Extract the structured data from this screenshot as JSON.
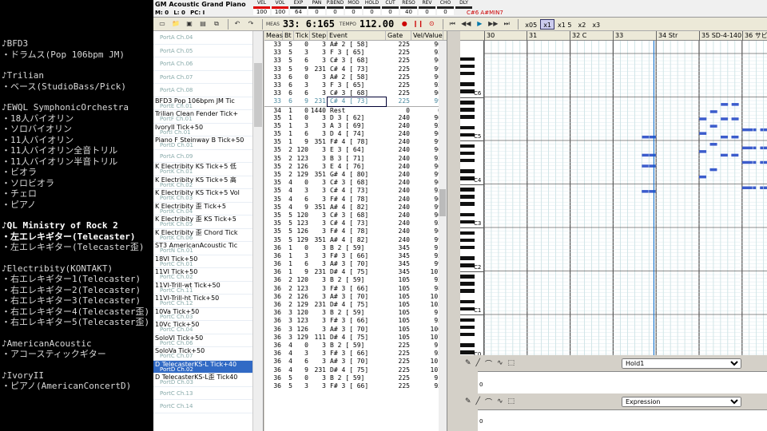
{
  "overlay": {
    "groups": [
      {
        "lines": [
          "♪BFD3",
          "・ドラムス(Pop 106bpm JM)"
        ]
      },
      {
        "lines": [
          "♪Trilian",
          "・ベース(StudioBass/Pick)"
        ]
      },
      {
        "lines": [
          "♪EWQL SymphonicOrchestra",
          "・18人バイオリン",
          "・ソロバイオリン",
          "・11人バイオリン",
          "・11人バイオリン全音トリル",
          "・11人バイオリン半音トリル",
          "・ビオラ",
          "・ソロビオラ",
          "・チェロ",
          "・ピアノ"
        ]
      },
      {
        "lines": [
          "♪QL Ministry of Rock 2",
          "・左エレキギター(Telecaster)",
          "・左エレキギター(Telecaster歪)"
        ],
        "current": [
          0,
          1
        ]
      },
      {
        "lines": [
          "♪Electribity(KONTAKT)",
          "・右エレキギター1(Telecaster)",
          "・右エレキギター2(Telecaster)",
          "・右エレキギター3(Telecaster)",
          "・右エレキギター4(Telecaster歪)",
          "・右エレキギター5(Telecaster歪)"
        ]
      },
      {
        "lines": [
          "♪AmericanAcoustic",
          "・アコースティックギター"
        ]
      },
      {
        "lines": [
          "♪IvoryII",
          "・ピアノ(AmericanConcertD)"
        ]
      }
    ]
  },
  "header": {
    "instrument": "GM Acoustic Grand Piano",
    "status": {
      "m": "M: 0",
      "l": "L: 0",
      "pc": "PC: I"
    },
    "meters": [
      {
        "label": "VEL",
        "value": "100"
      },
      {
        "label": "VOL",
        "value": "100"
      },
      {
        "label": "EXP",
        "value": "64"
      },
      {
        "label": "PAN",
        "value": "0"
      },
      {
        "label": "P.BEND",
        "value": "0"
      },
      {
        "label": "MOD",
        "value": "0"
      },
      {
        "label": "HOLD",
        "value": "0"
      },
      {
        "label": "CUT",
        "value": "0"
      },
      {
        "label": "RESO",
        "value": "40"
      },
      {
        "label": "REV",
        "value": "0"
      },
      {
        "label": "CHO",
        "value": "0"
      },
      {
        "label": "DLY",
        "value": ""
      }
    ],
    "key_info": "C#6 A#MIN7"
  },
  "toolbar": {
    "meas_label": "MEAS",
    "position": "33: 6:165",
    "tempo_label": "TEMPO",
    "tempo": "112.00",
    "zoom": [
      "x05",
      "x1",
      "x1 5",
      "x2",
      "x3"
    ]
  },
  "tracks": [
    {
      "name": "",
      "port": "PortA Ch.04"
    },
    {
      "name": "",
      "port": "PortA Ch.05"
    },
    {
      "name": "",
      "port": "PortA Ch.06"
    },
    {
      "name": "",
      "port": "PortA Ch.07"
    },
    {
      "name": "",
      "port": "PortA Ch.08"
    },
    {
      "name": "BFD3 Pop 106bpm JM Tic",
      "port": "PortE Ch.01"
    },
    {
      "name": "Trilian Clean Fender Tick+",
      "port": "PortF Ch.01"
    },
    {
      "name": "IvoryII Tick+50",
      "port": "PortI Ch.01"
    },
    {
      "name": "Piano F Steinway B Tick+50",
      "port": "PortD Ch.01"
    },
    {
      "name": "",
      "port": "PortA Ch.09"
    },
    {
      "name": "K Electribity KS Tick+5 低",
      "port": "PortK Ch.01"
    },
    {
      "name": "K Electribity KS Tick+5 高",
      "port": "PortK Ch.02"
    },
    {
      "name": "K Electribity KS Tick+5 Vol",
      "port": "PortK Ch.03"
    },
    {
      "name": "K Electribity 歪 Tick+5",
      "port": "PortK Ch.04"
    },
    {
      "name": "K Electribity 歪 KS Tick+5",
      "port": "PortK Ch.05"
    },
    {
      "name": "K Electribity 歪 Chord Tick",
      "port": "PortK Ch.06"
    },
    {
      "name": "ST3 AmericanAcoustic Tic",
      "port": "PortN Ch.01"
    },
    {
      "name": "18VI Tick+50",
      "port": "PortC Ch.01"
    },
    {
      "name": "11VI Tick+50",
      "port": "PortC Ch.02"
    },
    {
      "name": "11VI-Trill-wt Tick+50",
      "port": "PortC Ch.11"
    },
    {
      "name": "11VI-Trill-ht Tick+50",
      "port": "PortC Ch.12"
    },
    {
      "name": "10Va Tick+50",
      "port": "PortC Ch.03"
    },
    {
      "name": "10Vc Tick+50",
      "port": "PortC Ch.04"
    },
    {
      "name": "SoloVI Tick+50",
      "port": "PortC Ch.06"
    },
    {
      "name": "SoloVa Tick+50",
      "port": "PortC Ch.07"
    },
    {
      "name": "D TelecasterKS-L Tick+40",
      "port": "PortD Ch.02",
      "selected": true
    },
    {
      "name": "D TelecasterKS-L歪 Tick40",
      "port": "PortD Ch.03"
    },
    {
      "name": "",
      "port": "PortC Ch.13"
    },
    {
      "name": "",
      "port": "PortC Ch.14"
    }
  ],
  "event_columns": [
    "Meas",
    "Bt",
    "Tick",
    "Step",
    "Event",
    "Gate",
    "Vel/Value"
  ],
  "events": [
    [
      "33",
      "5",
      "0",
      "3",
      "A# 2 [ 58]",
      "225",
      "90"
    ],
    [
      "33",
      "5",
      "3",
      "3",
      "F 3 [ 65]",
      "225",
      "93"
    ],
    [
      "33",
      "5",
      "6",
      "3",
      "C# 3 [ 68]",
      "225",
      "96"
    ],
    [
      "33",
      "5",
      "9",
      "231",
      "C# 4 [ 73]",
      "225",
      "99"
    ],
    [
      "33",
      "6",
      "0",
      "3",
      "A# 2 [ 58]",
      "225",
      "90"
    ],
    [
      "33",
      "6",
      "3",
      "3",
      "F 3 [ 65]",
      "225",
      "93"
    ],
    [
      "33",
      "6",
      "6",
      "3",
      "C# 3 [ 68]",
      "225",
      "96"
    ],
    [
      "33",
      "6",
      "9",
      "231",
      "C# 4 [ 73]",
      "225",
      "99"
    ],
    [
      "34",
      "1",
      "0",
      "1440",
      "Rest",
      "0",
      "0"
    ],
    [
      "35",
      "1",
      "0",
      "3",
      "D 3 [ 62]",
      "240",
      "90"
    ],
    [
      "35",
      "1",
      "3",
      "3",
      "A 3 [ 69]",
      "240",
      "93"
    ],
    [
      "35",
      "1",
      "6",
      "3",
      "D 4 [ 74]",
      "240",
      "96"
    ],
    [
      "35",
      "1",
      "9",
      "351",
      "F# 4 [ 78]",
      "240",
      "99"
    ],
    [
      "35",
      "2",
      "120",
      "3",
      "E 3 [ 64]",
      "240",
      "90"
    ],
    [
      "35",
      "2",
      "123",
      "3",
      "B 3 [ 71]",
      "240",
      "93"
    ],
    [
      "35",
      "2",
      "126",
      "3",
      "E 4 [ 76]",
      "240",
      "96"
    ],
    [
      "35",
      "2",
      "129",
      "351",
      "G# 4 [ 80]",
      "240",
      "99"
    ],
    [
      "35",
      "4",
      "0",
      "3",
      "C# 3 [ 68]",
      "240",
      "90"
    ],
    [
      "35",
      "4",
      "3",
      "3",
      "C# 4 [ 73]",
      "240",
      "93"
    ],
    [
      "35",
      "4",
      "6",
      "3",
      "F# 4 [ 78]",
      "240",
      "96"
    ],
    [
      "35",
      "4",
      "9",
      "351",
      "A# 4 [ 82]",
      "240",
      "99"
    ],
    [
      "35",
      "5",
      "120",
      "3",
      "C# 3 [ 68]",
      "240",
      "90"
    ],
    [
      "35",
      "5",
      "123",
      "3",
      "C# 4 [ 73]",
      "240",
      "93"
    ],
    [
      "35",
      "5",
      "126",
      "3",
      "F# 4 [ 78]",
      "240",
      "96"
    ],
    [
      "35",
      "5",
      "129",
      "351",
      "A# 4 [ 82]",
      "240",
      "99"
    ],
    [
      "36",
      "1",
      "0",
      "3",
      "B 2 [ 59]",
      "345",
      "91"
    ],
    [
      "36",
      "1",
      "3",
      "3",
      "F# 3 [ 66]",
      "345",
      "95"
    ],
    [
      "36",
      "1",
      "6",
      "3",
      "A# 3 [ 70]",
      "345",
      "99"
    ],
    [
      "36",
      "1",
      "9",
      "231",
      "D# 4 [ 75]",
      "345",
      "107"
    ],
    [
      "36",
      "2",
      "120",
      "3",
      "B 2 [ 59]",
      "105",
      "92"
    ],
    [
      "36",
      "2",
      "123",
      "3",
      "F# 3 [ 66]",
      "105",
      "98"
    ],
    [
      "36",
      "2",
      "126",
      "3",
      "A# 3 [ 70]",
      "105",
      "101"
    ],
    [
      "36",
      "2",
      "129",
      "231",
      "D# 4 [ 75]",
      "105",
      "103"
    ],
    [
      "36",
      "3",
      "120",
      "3",
      "B 2 [ 59]",
      "105",
      "91"
    ],
    [
      "36",
      "3",
      "123",
      "3",
      "F# 3 [ 66]",
      "105",
      "95"
    ],
    [
      "36",
      "3",
      "126",
      "3",
      "A# 3 [ 70]",
      "105",
      "100"
    ],
    [
      "36",
      "3",
      "129",
      "111",
      "D# 4 [ 75]",
      "105",
      "107"
    ],
    [
      "36",
      "4",
      "0",
      "3",
      "B 2 [ 59]",
      "225",
      "91"
    ],
    [
      "36",
      "4",
      "3",
      "3",
      "F# 3 [ 66]",
      "225",
      "95"
    ],
    [
      "36",
      "4",
      "6",
      "3",
      "A# 3 [ 70]",
      "225",
      "101"
    ],
    [
      "36",
      "4",
      "9",
      "231",
      "D# 4 [ 75]",
      "225",
      "107"
    ],
    [
      "36",
      "5",
      "0",
      "3",
      "B 2 [ 59]",
      "225",
      "91"
    ],
    [
      "36",
      "5",
      "3",
      "3",
      "F# 3 [ 66]",
      "225",
      "95"
    ]
  ],
  "ruler": {
    "marks": [
      "30",
      "31",
      "32 C",
      "33",
      "34 Str",
      "35 SD-4-140",
      "36 サビ"
    ]
  },
  "keys": {
    "octaves": [
      "C6",
      "C5",
      "C4",
      "C3",
      "C2",
      "C1",
      "C0"
    ]
  },
  "controllers": {
    "hold_select": "Hold1",
    "hold_value": "0",
    "exp_select": "Expression",
    "exp_value": "0"
  },
  "colors": {
    "note": "#3b5ccc",
    "selected_track": "#316ac5",
    "grid_line": "#9cc"
  }
}
